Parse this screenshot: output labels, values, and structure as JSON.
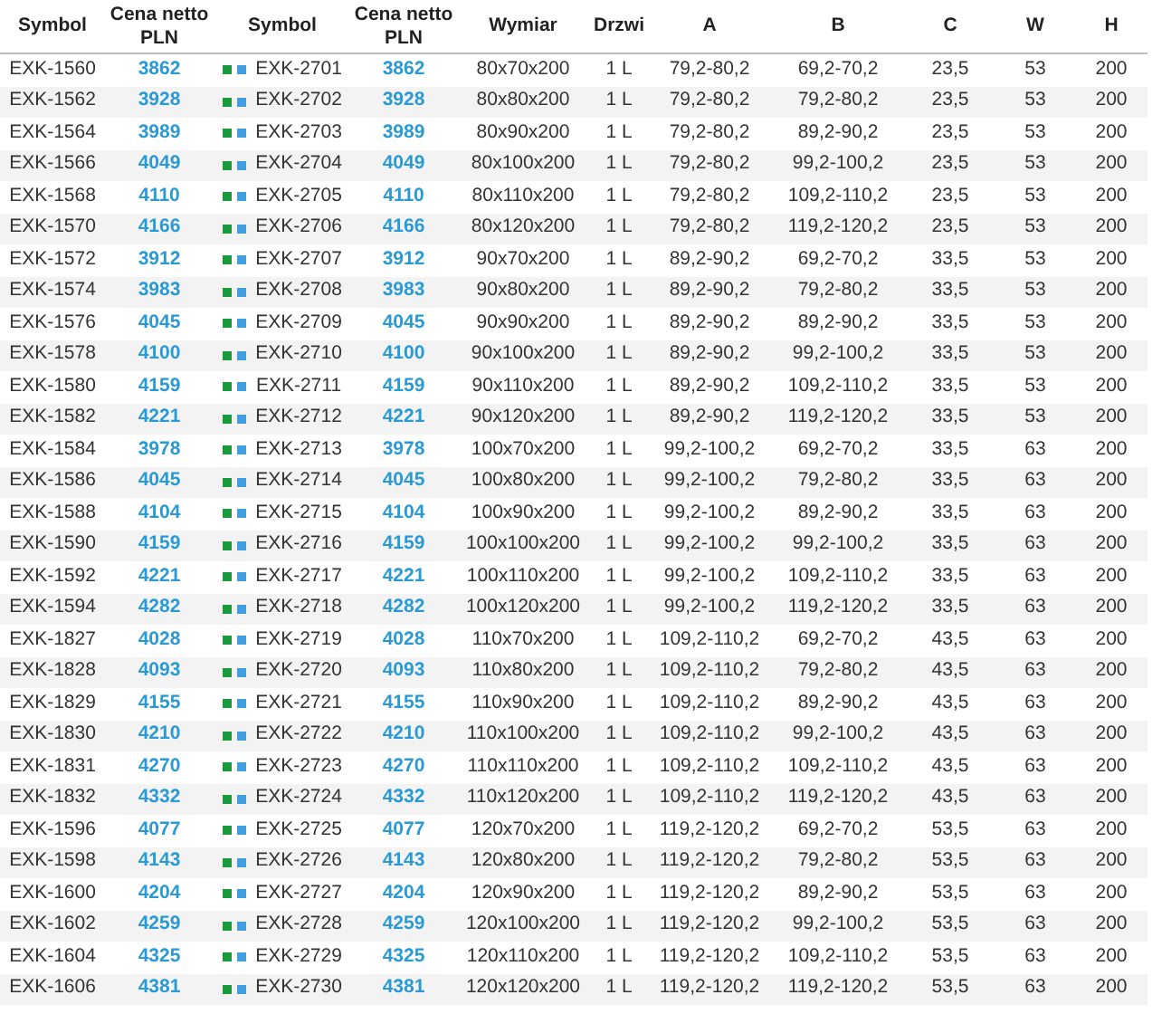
{
  "table": {
    "columns": [
      {
        "label": "Symbol",
        "kind": "text"
      },
      {
        "label": "Cena netto PLN",
        "kind": "price"
      },
      {
        "label": "Symbol",
        "kind": "marked"
      },
      {
        "label": "Cena netto PLN",
        "kind": "price"
      },
      {
        "label": "Wymiar",
        "kind": "text"
      },
      {
        "label": "Drzwi",
        "kind": "text"
      },
      {
        "label": "A",
        "kind": "text"
      },
      {
        "label": "B",
        "kind": "text"
      },
      {
        "label": "C",
        "kind": "text"
      },
      {
        "label": "W",
        "kind": "text"
      },
      {
        "label": "H",
        "kind": "text"
      }
    ],
    "rows": [
      [
        "EXK-1560",
        "3862",
        "EXK-2701",
        "3862",
        "80x70x200",
        "1 L",
        "79,2-80,2",
        "69,2-70,2",
        "23,5",
        "53",
        "200"
      ],
      [
        "EXK-1562",
        "3928",
        "EXK-2702",
        "3928",
        "80x80x200",
        "1 L",
        "79,2-80,2",
        "79,2-80,2",
        "23,5",
        "53",
        "200"
      ],
      [
        "EXK-1564",
        "3989",
        "EXK-2703",
        "3989",
        "80x90x200",
        "1 L",
        "79,2-80,2",
        "89,2-90,2",
        "23,5",
        "53",
        "200"
      ],
      [
        "EXK-1566",
        "4049",
        "EXK-2704",
        "4049",
        "80x100x200",
        "1 L",
        "79,2-80,2",
        "99,2-100,2",
        "23,5",
        "53",
        "200"
      ],
      [
        "EXK-1568",
        "4110",
        "EXK-2705",
        "4110",
        "80x110x200",
        "1 L",
        "79,2-80,2",
        "109,2-110,2",
        "23,5",
        "53",
        "200"
      ],
      [
        "EXK-1570",
        "4166",
        "EXK-2706",
        "4166",
        "80x120x200",
        "1 L",
        "79,2-80,2",
        "119,2-120,2",
        "23,5",
        "53",
        "200"
      ],
      [
        "EXK-1572",
        "3912",
        "EXK-2707",
        "3912",
        "90x70x200",
        "1 L",
        "89,2-90,2",
        "69,2-70,2",
        "33,5",
        "53",
        "200"
      ],
      [
        "EXK-1574",
        "3983",
        "EXK-2708",
        "3983",
        "90x80x200",
        "1 L",
        "89,2-90,2",
        "79,2-80,2",
        "33,5",
        "53",
        "200"
      ],
      [
        "EXK-1576",
        "4045",
        "EXK-2709",
        "4045",
        "90x90x200",
        "1 L",
        "89,2-90,2",
        "89,2-90,2",
        "33,5",
        "53",
        "200"
      ],
      [
        "EXK-1578",
        "4100",
        "EXK-2710",
        "4100",
        "90x100x200",
        "1 L",
        "89,2-90,2",
        "99,2-100,2",
        "33,5",
        "53",
        "200"
      ],
      [
        "EXK-1580",
        "4159",
        "EXK-2711",
        "4159",
        "90x110x200",
        "1 L",
        "89,2-90,2",
        "109,2-110,2",
        "33,5",
        "53",
        "200"
      ],
      [
        "EXK-1582",
        "4221",
        "EXK-2712",
        "4221",
        "90x120x200",
        "1 L",
        "89,2-90,2",
        "119,2-120,2",
        "33,5",
        "53",
        "200"
      ],
      [
        "EXK-1584",
        "3978",
        "EXK-2713",
        "3978",
        "100x70x200",
        "1 L",
        "99,2-100,2",
        "69,2-70,2",
        "33,5",
        "63",
        "200"
      ],
      [
        "EXK-1586",
        "4045",
        "EXK-2714",
        "4045",
        "100x80x200",
        "1 L",
        "99,2-100,2",
        "79,2-80,2",
        "33,5",
        "63",
        "200"
      ],
      [
        "EXK-1588",
        "4104",
        "EXK-2715",
        "4104",
        "100x90x200",
        "1 L",
        "99,2-100,2",
        "89,2-90,2",
        "33,5",
        "63",
        "200"
      ],
      [
        "EXK-1590",
        "4159",
        "EXK-2716",
        "4159",
        "100x100x200",
        "1 L",
        "99,2-100,2",
        "99,2-100,2",
        "33,5",
        "63",
        "200"
      ],
      [
        "EXK-1592",
        "4221",
        "EXK-2717",
        "4221",
        "100x110x200",
        "1 L",
        "99,2-100,2",
        "109,2-110,2",
        "33,5",
        "63",
        "200"
      ],
      [
        "EXK-1594",
        "4282",
        "EXK-2718",
        "4282",
        "100x120x200",
        "1 L",
        "99,2-100,2",
        "119,2-120,2",
        "33,5",
        "63",
        "200"
      ],
      [
        "EXK-1827",
        "4028",
        "EXK-2719",
        "4028",
        "110x70x200",
        "1 L",
        "109,2-110,2",
        "69,2-70,2",
        "43,5",
        "63",
        "200"
      ],
      [
        "EXK-1828",
        "4093",
        "EXK-2720",
        "4093",
        "110x80x200",
        "1 L",
        "109,2-110,2",
        "79,2-80,2",
        "43,5",
        "63",
        "200"
      ],
      [
        "EXK-1829",
        "4155",
        "EXK-2721",
        "4155",
        "110x90x200",
        "1 L",
        "109,2-110,2",
        "89,2-90,2",
        "43,5",
        "63",
        "200"
      ],
      [
        "EXK-1830",
        "4210",
        "EXK-2722",
        "4210",
        "110x100x200",
        "1 L",
        "109,2-110,2",
        "99,2-100,2",
        "43,5",
        "63",
        "200"
      ],
      [
        "EXK-1831",
        "4270",
        "EXK-2723",
        "4270",
        "110x110x200",
        "1 L",
        "109,2-110,2",
        "109,2-110,2",
        "43,5",
        "63",
        "200"
      ],
      [
        "EXK-1832",
        "4332",
        "EXK-2724",
        "4332",
        "110x120x200",
        "1 L",
        "109,2-110,2",
        "119,2-120,2",
        "43,5",
        "63",
        "200"
      ],
      [
        "EXK-1596",
        "4077",
        "EXK-2725",
        "4077",
        "120x70x200",
        "1 L",
        "119,2-120,2",
        "69,2-70,2",
        "53,5",
        "63",
        "200"
      ],
      [
        "EXK-1598",
        "4143",
        "EXK-2726",
        "4143",
        "120x80x200",
        "1 L",
        "119,2-120,2",
        "79,2-80,2",
        "53,5",
        "63",
        "200"
      ],
      [
        "EXK-1600",
        "4204",
        "EXK-2727",
        "4204",
        "120x90x200",
        "1 L",
        "119,2-120,2",
        "89,2-90,2",
        "53,5",
        "63",
        "200"
      ],
      [
        "EXK-1602",
        "4259",
        "EXK-2728",
        "4259",
        "120x100x200",
        "1 L",
        "119,2-120,2",
        "99,2-100,2",
        "53,5",
        "63",
        "200"
      ],
      [
        "EXK-1604",
        "4325",
        "EXK-2729",
        "4325",
        "120x110x200",
        "1 L",
        "119,2-120,2",
        "109,2-110,2",
        "53,5",
        "63",
        "200"
      ],
      [
        "EXK-1606",
        "4381",
        "EXK-2730",
        "4381",
        "120x120x200",
        "1 L",
        "119,2-120,2",
        "119,2-120,2",
        "53,5",
        "63",
        "200"
      ]
    ]
  }
}
